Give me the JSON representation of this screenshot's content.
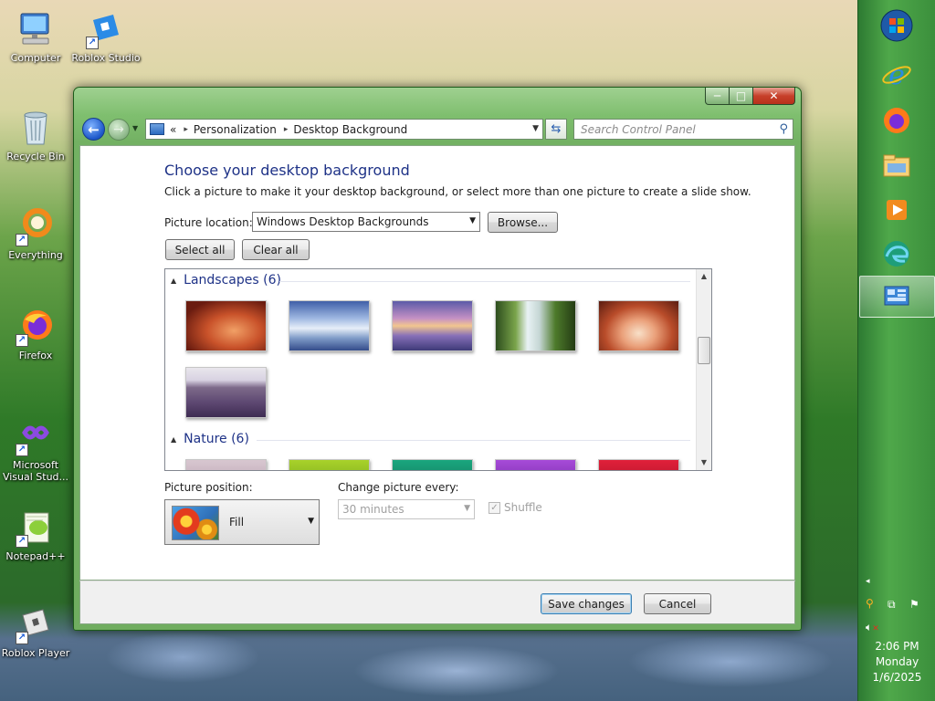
{
  "desktop": {
    "icons": [
      {
        "label": "Computer"
      },
      {
        "label": "Roblox Studio"
      },
      {
        "label": "Recycle Bin"
      },
      {
        "label": "Everything"
      },
      {
        "label": "Firefox"
      },
      {
        "label": "Microsoft Visual Stud..."
      },
      {
        "label": "Notepad++"
      },
      {
        "label": "Roblox Player"
      }
    ]
  },
  "window": {
    "controls": {
      "minimize": "─",
      "maximize": "□",
      "close": "✕"
    },
    "address": {
      "overflow": "«",
      "segments": [
        "Personalization",
        "Desktop Background"
      ],
      "separator": "▸"
    },
    "search_placeholder": "Search Control Panel",
    "heading": "Choose your desktop background",
    "description": "Click a picture to make it your desktop background, or select more than one picture to create a slide show.",
    "picture_location_label": "Picture location:",
    "picture_location_value": "Windows Desktop Backgrounds",
    "browse_label": "Browse...",
    "select_all_label": "Select all",
    "clear_all_label": "Clear all",
    "groups": [
      {
        "title": "Landscapes (6)"
      },
      {
        "title": "Nature (6)"
      }
    ],
    "picture_position_label": "Picture position:",
    "picture_position_value": "Fill",
    "change_every_label": "Change picture every:",
    "change_every_value": "30 minutes",
    "shuffle_label": "Shuffle",
    "save_label": "Save changes",
    "cancel_label": "Cancel"
  },
  "taskbar": {
    "time": "2:06 PM",
    "day": "Monday",
    "date": "1/6/2025"
  },
  "colors": {
    "accent_heading": "#1e3287",
    "window_frame": "#7fbf6f",
    "close_button": "#c7402a"
  }
}
